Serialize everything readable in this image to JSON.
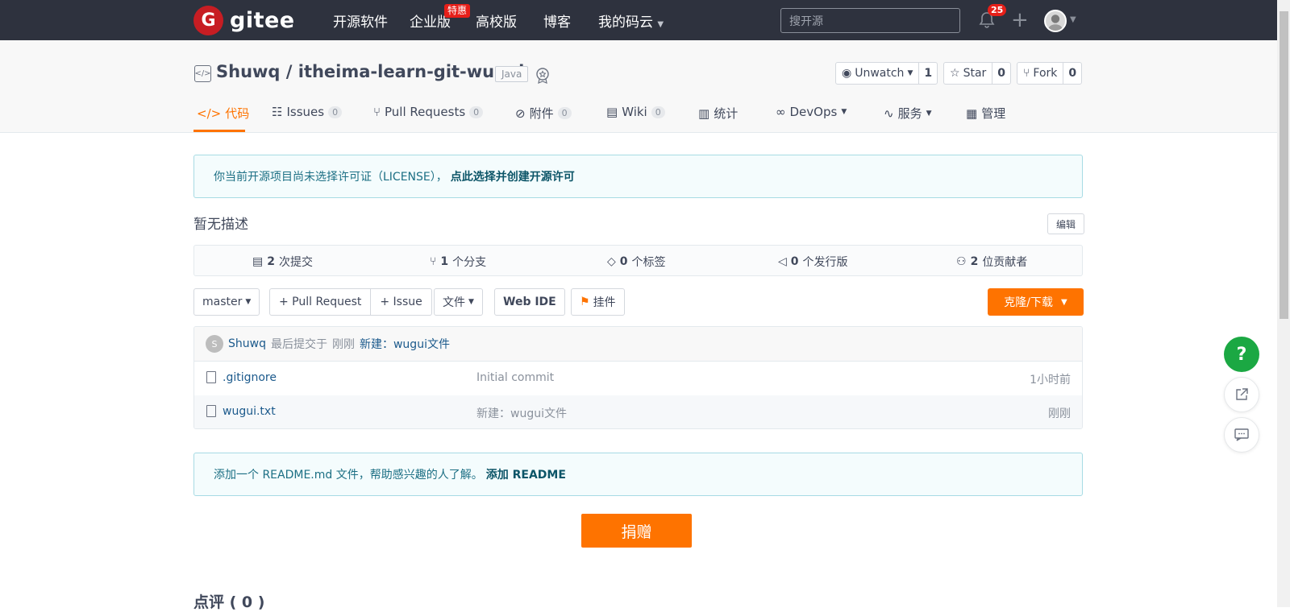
{
  "nav": {
    "logo_letter": "G",
    "logo_text": "gitee",
    "links": [
      "开源软件",
      "企业版",
      "高校版",
      "博客",
      "我的码云"
    ],
    "enterprise_badge": "特惠",
    "search_placeholder": "搜开源",
    "notification_count": "25",
    "plus_icon": "plus-icon",
    "brand_color": "#c71d23"
  },
  "repo": {
    "title": "Shuwq / itheima-learn-git-wugui",
    "language": "Java",
    "watch_label": "Unwatch",
    "watch_count": "1",
    "star_label": "Star",
    "star_count": "0",
    "fork_label": "Fork",
    "fork_count": "0"
  },
  "tabs": [
    {
      "label": "代码",
      "count": ""
    },
    {
      "label": "Issues",
      "count": "0"
    },
    {
      "label": "Pull Requests",
      "count": "0"
    },
    {
      "label": "附件",
      "count": "0"
    },
    {
      "label": "Wiki",
      "count": "0"
    },
    {
      "label": "统计",
      "count": ""
    },
    {
      "label": "DevOps",
      "count": ""
    },
    {
      "label": "服务",
      "count": ""
    },
    {
      "label": "管理",
      "count": ""
    }
  ],
  "license_notice": {
    "text": "你当前开源项目尚未选择许可证（LICENSE），",
    "link": "点此选择并创建开源许可"
  },
  "description": "暂无描述",
  "edit_label": "编辑",
  "stats": [
    {
      "num": "2",
      "label": "次提交"
    },
    {
      "num": "1",
      "label": "个分支"
    },
    {
      "num": "0",
      "label": "个标签"
    },
    {
      "num": "0",
      "label": "个发行版"
    },
    {
      "num": "2",
      "label": "位贡献者"
    }
  ],
  "toolbar": {
    "branch": "master",
    "pull_request": "+ Pull Request",
    "issue": "+ Issue",
    "file": "文件",
    "web_ide": "Web IDE",
    "widget": "挂件",
    "clone": "克隆/下载",
    "accent": "#fe7300"
  },
  "last_commit": {
    "avatar_letter": "S",
    "author": "Shuwq",
    "text": "最后提交于",
    "time": "刚刚",
    "message": "新建：wugui文件"
  },
  "files": [
    {
      "name": ".gitignore",
      "message": "Initial commit",
      "time": "1小时前"
    },
    {
      "name": "wugui.txt",
      "message": "新建：wugui文件",
      "time": "刚刚"
    }
  ],
  "readme_notice": {
    "text": "添加一个 README.md 文件，帮助感兴趣的人了解。",
    "link": "添加 README"
  },
  "donate_label": "捐赠",
  "review_title": "点评 ( 0 )",
  "help_label": "?"
}
